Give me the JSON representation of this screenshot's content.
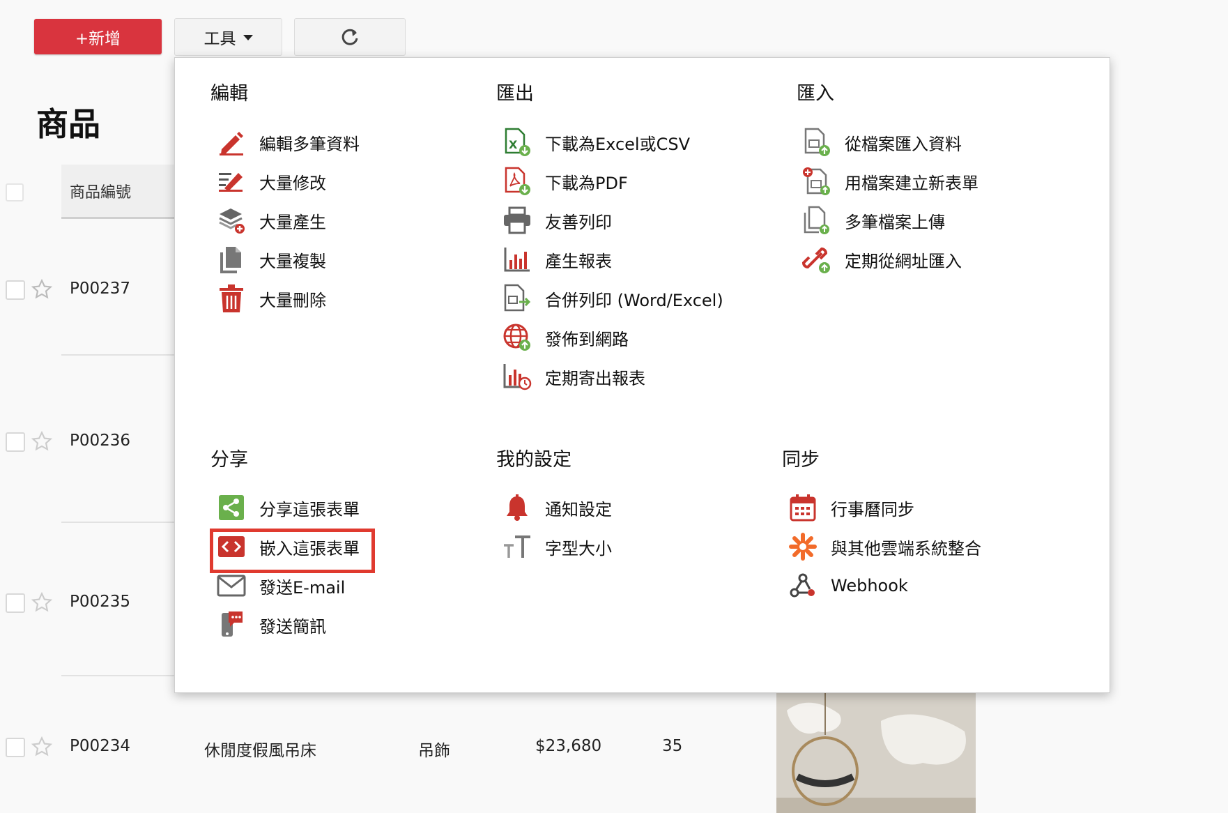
{
  "toolbar": {
    "new_label": "+新增",
    "tools_label": "工具",
    "refresh_icon": "refresh-icon"
  },
  "page": {
    "title": "商品",
    "column_header": "商品編號"
  },
  "rows": [
    {
      "code": "P00237"
    },
    {
      "code": "P00236"
    },
    {
      "code": "P00235"
    },
    {
      "code": "P00234",
      "name": "休閒度假風吊床",
      "category": "吊飾",
      "price": "$23,680",
      "qty": "35"
    }
  ],
  "menu": {
    "edit": {
      "title": "編輯",
      "items": [
        "編輯多筆資料",
        "大量修改",
        "大量產生",
        "大量複製",
        "大量刪除"
      ]
    },
    "export": {
      "title": "匯出",
      "items": [
        "下載為Excel或CSV",
        "下載為PDF",
        "友善列印",
        "產生報表",
        "合併列印 (Word/Excel)",
        "發佈到網路",
        "定期寄出報表"
      ]
    },
    "import": {
      "title": "匯入",
      "items": [
        "從檔案匯入資料",
        "用檔案建立新表單",
        "多筆檔案上傳",
        "定期從網址匯入"
      ]
    },
    "share": {
      "title": "分享",
      "items": [
        "分享這張表單",
        "嵌入這張表單",
        "發送E-mail",
        "發送簡訊"
      ]
    },
    "settings": {
      "title": "我的設定",
      "items": [
        "通知設定",
        "字型大小"
      ]
    },
    "sync": {
      "title": "同步",
      "items": [
        "行事曆同步",
        "與其他雲端系統整合",
        "Webhook"
      ]
    }
  },
  "colors": {
    "accent": "#d9343e",
    "highlight": "#e03a2f",
    "green": "#6ab04c"
  }
}
